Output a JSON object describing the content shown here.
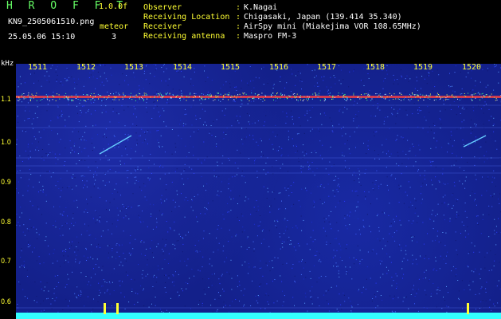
{
  "header": {
    "app_title": "H R O F F T",
    "version": "1.0.0f",
    "file_name": "KN9_2505061510.png",
    "meteor_label": "meteor",
    "datetime": "25.05.06 15:10",
    "meteor_count": "3"
  },
  "info": [
    {
      "label": "Observer",
      "value": "K.Nagai"
    },
    {
      "label": "Receiving Location",
      "value": "Chigasaki, Japan (139.414 35.340)"
    },
    {
      "label": "Receiver",
      "value": "AirSpy mini (Miakejima VOR 108.65MHz)"
    },
    {
      "label": "Receiving antenna",
      "value": "Maspro FM-3"
    }
  ],
  "axes": {
    "y_unit": "kHz",
    "y_ticks": [
      "1.1",
      "1.0",
      "0.9",
      "0.8",
      "0.7",
      "0.6"
    ],
    "x_ticks": [
      "1511",
      "1512",
      "1513",
      "1514",
      "1515",
      "1516",
      "1517",
      "1518",
      "1519",
      "1520"
    ]
  },
  "colors": {
    "background": "#000000",
    "label_yellow": "#ffff33",
    "title_green": "#66ff66",
    "spectrogram_base": "#13208a",
    "signal_line": "#ff4040",
    "baseline": "#33ffff"
  }
}
